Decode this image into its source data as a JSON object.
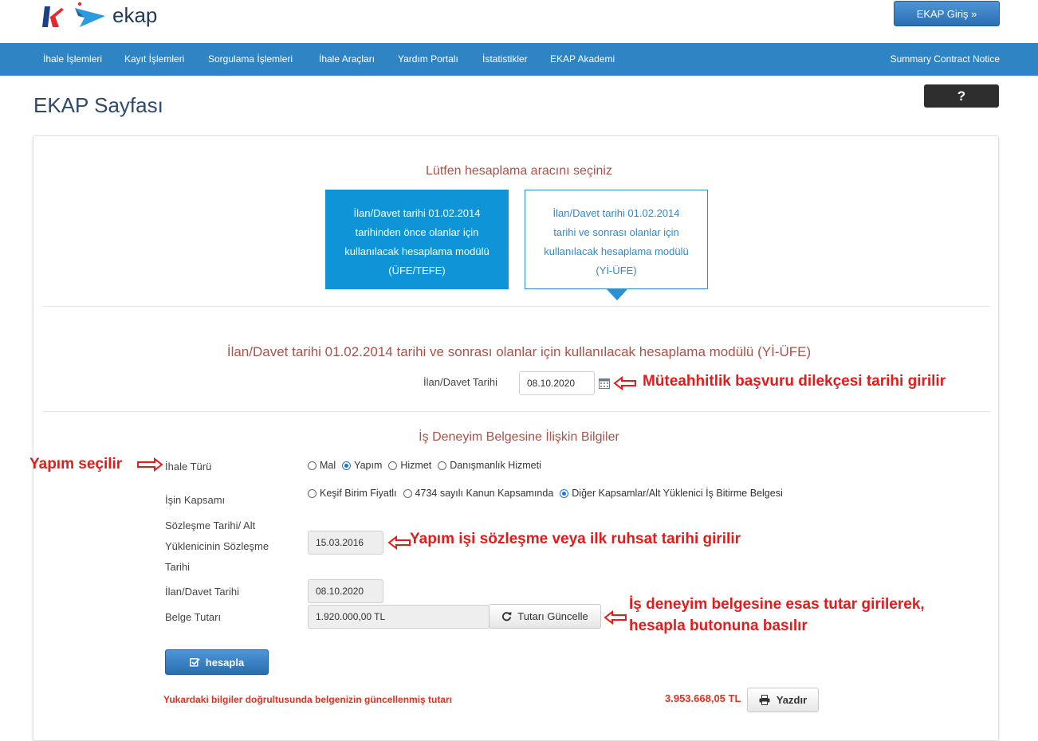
{
  "header": {
    "logo_text": "ekap",
    "login_label": "EKAP Giriş »"
  },
  "nav": {
    "items": [
      "İhale İşlemleri",
      "Kayıt İşlemleri",
      "Sorgulama İşlemleri",
      "İhale Araçları",
      "Yardım Portalı",
      "İstatistikler",
      "EKAP Akademi"
    ],
    "summary": "Summary Contract Notice"
  },
  "page": {
    "title": "EKAP Sayfası",
    "help_label": "?"
  },
  "tool_select": {
    "prompt": "Lütfen hesaplama aracını seçiniz",
    "card_old": "İlan/Davet tarihi 01.02.2014 tarihinden önce olanlar için kullanılacak hesaplama modülü (ÜFE/TEFE)",
    "card_new": "İlan/Davet tarihi 01.02.2014 tarihi ve sonrası olanlar için kullanılacak hesaplama modülü (Yİ-ÜFE)"
  },
  "module": {
    "title": "İlan/Davet tarihi 01.02.2014 tarihi ve sonrası olanlar için kullanılacak hesaplama modülü (Yİ-ÜFE)",
    "date_label": "İlan/Davet Tarihi",
    "date_value": "08.10.2020"
  },
  "form": {
    "section_title": "İş Deneyim Belgesine İlişkin Bilgiler",
    "tender_type_label": "İhale Türü",
    "tender_types": [
      "Mal",
      "Yapım",
      "Hizmet",
      "Danışmanlık Hizmeti"
    ],
    "tender_type_selected": "Yapım",
    "scope_label": "İşin Kapsamı",
    "scopes": [
      "Keşif Birim Fiyatlı",
      "4734 sayılı Kanun Kapsamında",
      "Diğer Kapsamlar/Alt Yüklenici İş Bitirme Belgesi"
    ],
    "scope_selected": "Diğer Kapsamlar/Alt Yüklenici İş Bitirme Belgesi",
    "contract_date_label_lines": [
      "Sözleşme Tarihi/ Alt",
      "Yüklenicinin Sözleşme",
      "Tarihi"
    ],
    "contract_date_value": "15.03.2016",
    "invite_date_label": "İlan/Davet Tarihi",
    "invite_date_value": "08.10.2020",
    "amount_label": "Belge Tutarı",
    "amount_value": "1.920.000,00 TL",
    "update_label": "Tutarı Güncelle",
    "calc_label": "hesapla"
  },
  "result": {
    "text": "Yukardaki bilgiler doğrultusunda belgenizin güncellenmiş tutarı",
    "value": "3.953.668,05 TL",
    "print_label": "Yazdır"
  },
  "annotations": {
    "date_note": "Müteahhitlik başvuru dilekçesi tarihi girilir",
    "type_note": "Yapım seçilir",
    "contract_note": "Yapım işi sözleşme veya ilk ruhsat tarihi girilir",
    "amount_note_line1": "İş deneyim belgesine esas tutar girilerek,",
    "amount_note_line2": "hesapla butonuna basılır"
  },
  "colors": {
    "nav_bg": "#2f84c4",
    "card_active": "#0f94d8",
    "annotation_red": "#e41b1b",
    "section_title": "#a9534b"
  }
}
